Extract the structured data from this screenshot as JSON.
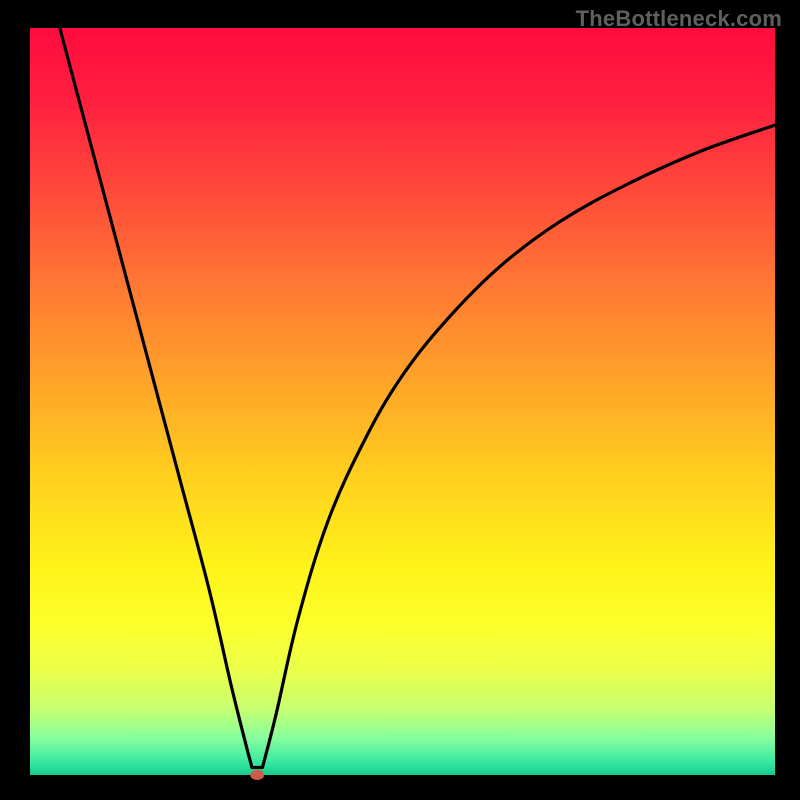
{
  "watermark": "TheBottleneck.com",
  "chart_data": {
    "type": "line",
    "title": "",
    "xlabel": "",
    "ylabel": "",
    "xlim": [
      0,
      100
    ],
    "ylim": [
      0,
      100
    ],
    "note": "Axes unlabeled in source image; x and y are normalized 0–100 estimates read from curve geometry relative to the plotting area.",
    "marker": {
      "x": 30.5,
      "y": 0,
      "color": "#d05a4a",
      "radius_px": 6
    },
    "series": [
      {
        "name": "bottleneck-curve-left",
        "x": [
          4.0,
          8.0,
          12.0,
          16.0,
          20.0,
          24.0,
          27.0,
          29.0,
          29.8
        ],
        "y": [
          100.0,
          85.0,
          70.0,
          55.0,
          40.0,
          25.0,
          12.0,
          4.0,
          1.0
        ]
      },
      {
        "name": "bottleneck-curve-flat",
        "x": [
          29.8,
          31.2
        ],
        "y": [
          1.0,
          1.0
        ]
      },
      {
        "name": "bottleneck-curve-right",
        "x": [
          31.2,
          33.0,
          36.0,
          40.0,
          45.0,
          50.0,
          56.0,
          63.0,
          71.0,
          80.0,
          90.0,
          100.0
        ],
        "y": [
          1.0,
          8.0,
          21.0,
          34.0,
          45.0,
          53.5,
          61.0,
          68.0,
          74.0,
          79.0,
          83.5,
          87.0
        ]
      }
    ],
    "background_gradient": {
      "type": "vertical",
      "stops": [
        {
          "pos": 0.0,
          "color": "#ff0b3e"
        },
        {
          "pos": 0.1,
          "color": "#ff2040"
        },
        {
          "pos": 0.22,
          "color": "#ff4a3a"
        },
        {
          "pos": 0.35,
          "color": "#ff7a33"
        },
        {
          "pos": 0.48,
          "color": "#ffa628"
        },
        {
          "pos": 0.6,
          "color": "#ffcf1e"
        },
        {
          "pos": 0.72,
          "color": "#fff31a"
        },
        {
          "pos": 0.8,
          "color": "#fcff2b"
        },
        {
          "pos": 0.86,
          "color": "#eaff4a"
        },
        {
          "pos": 0.91,
          "color": "#c8ff6e"
        },
        {
          "pos": 0.95,
          "color": "#88ff9d"
        },
        {
          "pos": 0.985,
          "color": "#33e6a0"
        },
        {
          "pos": 1.0,
          "color": "#16c98c"
        }
      ]
    }
  }
}
